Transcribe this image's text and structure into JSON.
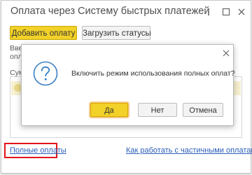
{
  "window": {
    "title": "Оплата через Систему быстрых платежей"
  },
  "toolbar": {
    "add_payment_label": "Добавить оплату",
    "load_statuses_label": "Загрузить статусы"
  },
  "background": {
    "text_line_1": "Вве",
    "text_line_2": "опл",
    "text_line_3": "Сум"
  },
  "footer": {
    "full_payments_link": "Полные оплаты",
    "partial_payments_link": "Как работать с частичными оплатами?"
  },
  "dialog": {
    "message": "Включить режим использования полных оплат?",
    "yes_label": "Да",
    "no_label": "Нет",
    "cancel_label": "Отмена",
    "icon": "question-icon"
  },
  "colors": {
    "accent_yellow": "#f2d128",
    "link_blue": "#2a5db8",
    "highlight_red": "#e0151b"
  }
}
